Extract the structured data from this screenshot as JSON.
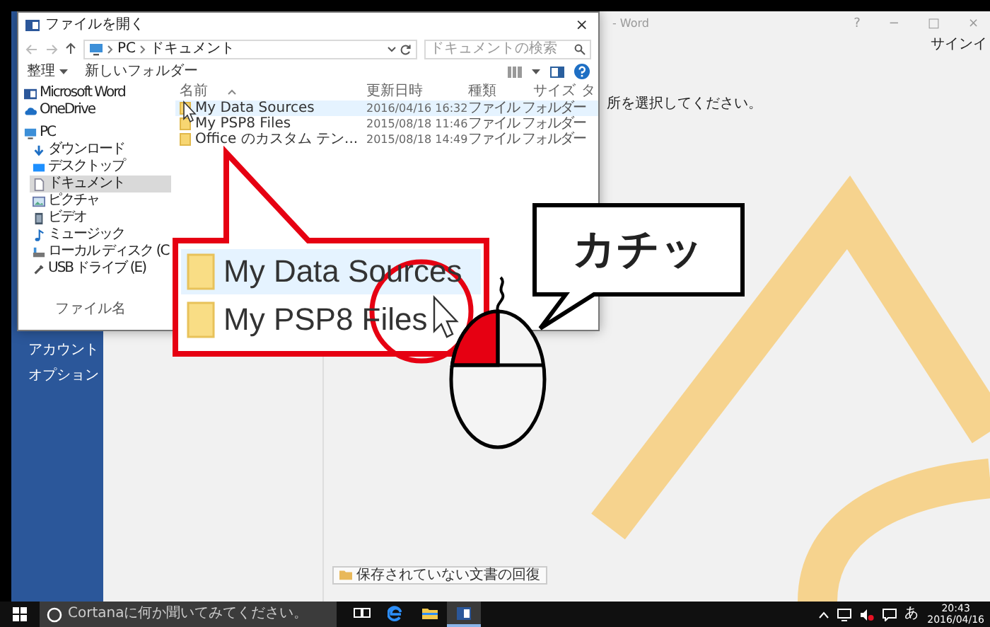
{
  "word": {
    "title": "- Word",
    "title_buttons": [
      "?",
      "−",
      "□",
      "×"
    ],
    "account_link": "サインイ",
    "prompt": "所を選択してください。",
    "sidebar": [
      {
        "label": "アカウント"
      },
      {
        "label": "オプション"
      }
    ],
    "recover_button": "保存されていない文書の回復"
  },
  "dialog": {
    "title": "ファイルを開く",
    "close": "×",
    "path": [
      "PC",
      "ドキュメント"
    ],
    "search_placeholder": "ドキュメントの検索",
    "organize": "整理",
    "new_folder": "新しいフォルダー",
    "nav": [
      {
        "label": "Microsoft Word",
        "kind": "app",
        "selected": false
      },
      {
        "label": "OneDrive",
        "kind": "cloud",
        "selected": false
      },
      {
        "label": "PC",
        "kind": "pc",
        "selected": false,
        "children": [
          {
            "label": "ダウンロード",
            "kind": "download",
            "selected": false
          },
          {
            "label": "デスクトップ",
            "kind": "desktop",
            "selected": false
          },
          {
            "label": "ドキュメント",
            "kind": "documents",
            "selected": true
          },
          {
            "label": "ピクチャ",
            "kind": "pictures",
            "selected": false
          },
          {
            "label": "ビデオ",
            "kind": "videos",
            "selected": false
          },
          {
            "label": "ミュージック",
            "kind": "music",
            "selected": false
          },
          {
            "label": "ローカル ディスク (C",
            "kind": "disk",
            "selected": false
          },
          {
            "label": "USB ドライブ (E)",
            "kind": "usb",
            "selected": false
          }
        ]
      }
    ],
    "columns": [
      "名前",
      "更新日時",
      "種類",
      "サイズ",
      "タ"
    ],
    "rows": [
      {
        "name": "My Data Sources",
        "modified": "2016/04/16 16:32",
        "type": "ファイル フォルダー",
        "selected": true
      },
      {
        "name": "My PSP8 Files",
        "modified": "2015/08/18 11:46",
        "type": "ファイル フォルダー",
        "selected": false
      },
      {
        "name": "Office のカスタム テン...",
        "modified": "2015/08/18 14:49",
        "type": "ファイル フォルダー",
        "selected": false
      }
    ],
    "filename_label": "ファイル名"
  },
  "callout": {
    "rows": [
      {
        "name": "My Data Sources",
        "selected": true
      },
      {
        "name": "My PSP8 Files",
        "selected": false
      }
    ]
  },
  "click_bubble": {
    "text": "カチッ"
  },
  "mouse": {
    "left_pressed": true
  },
  "taskbar": {
    "search_placeholder": "Cortanaに何か聞いてみてください。",
    "apps": [
      {
        "kind": "task-view",
        "selected": false
      },
      {
        "kind": "browser",
        "selected": false
      },
      {
        "kind": "folder",
        "selected": false
      },
      {
        "kind": "word",
        "selected": true
      }
    ],
    "ime": "あ",
    "time": "20:43",
    "date": "2016/04/16"
  }
}
